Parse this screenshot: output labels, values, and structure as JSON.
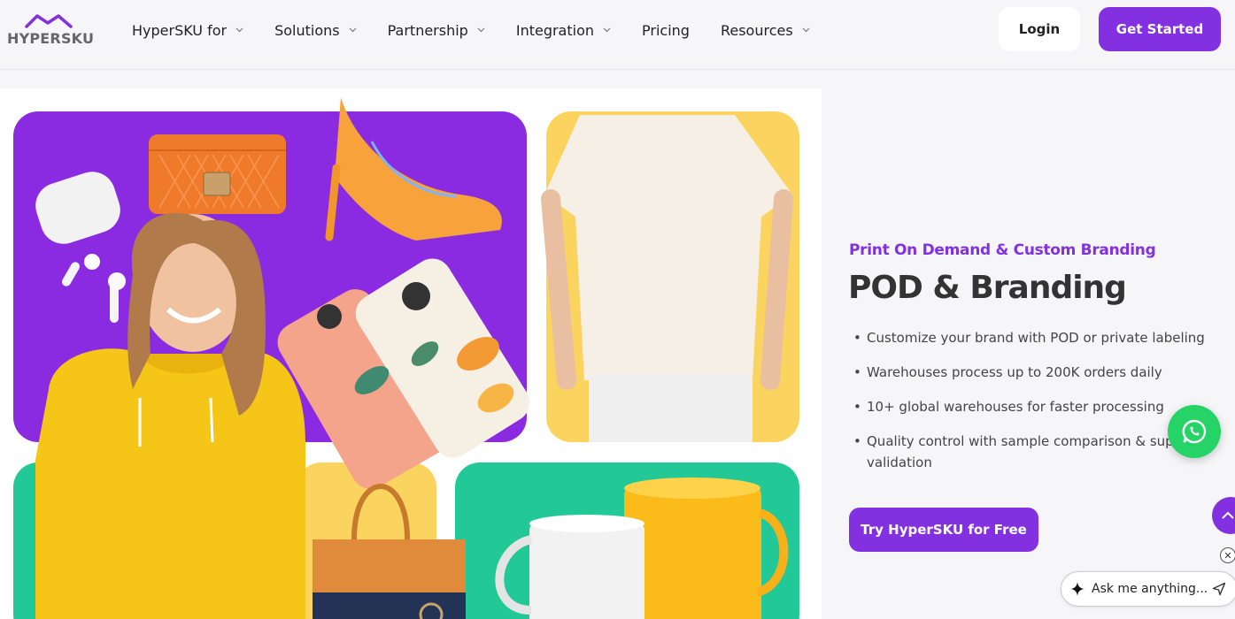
{
  "header": {
    "logo_text": "HYPERSKU",
    "nav": [
      {
        "label": "HyperSKU for",
        "dropdown": true
      },
      {
        "label": "Solutions",
        "dropdown": true
      },
      {
        "label": "Partnership",
        "dropdown": true
      },
      {
        "label": "Integration",
        "dropdown": true
      },
      {
        "label": "Pricing",
        "dropdown": false
      },
      {
        "label": "Resources",
        "dropdown": true
      }
    ],
    "login_label": "Login",
    "get_started_label": "Get Started"
  },
  "hero": {
    "eyebrow": "Print On Demand & Custom Branding",
    "title": "POD & Branding",
    "bullets": [
      "Customize your brand with POD or private labeling",
      "Warehouses process up to 200K orders daily",
      "10+ global warehouses for faster processing",
      "Quality control with sample comparison & supp validation"
    ],
    "cta_label": "Try HyperSKU for Free"
  },
  "widgets": {
    "whatsapp_icon": "whatsapp-icon",
    "scroll_top_icon": "chevron-up-icon",
    "close_label": "✕",
    "ask_placeholder": "Ask me anything..."
  },
  "colors": {
    "brand": "#8330e0",
    "purple_panel": "#8a2be2",
    "yellow_panel": "#fbd35f",
    "green_panel": "#22c997",
    "whatsapp": "#25d366"
  }
}
